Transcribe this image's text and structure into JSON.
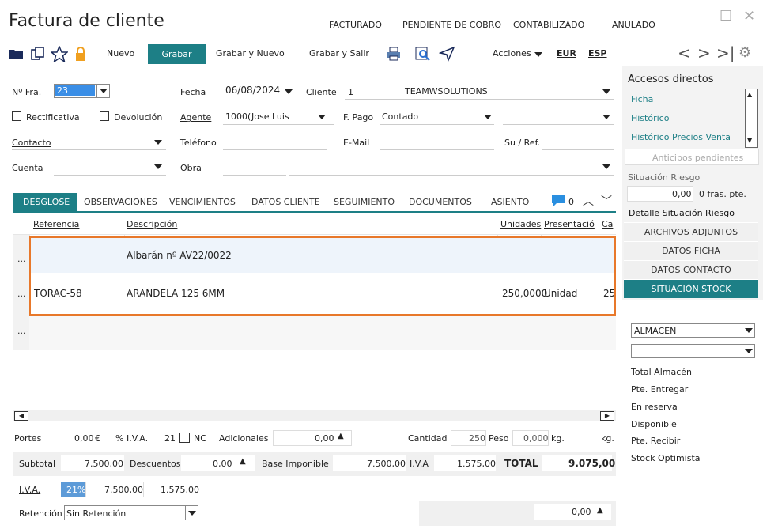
{
  "title": "Factura de cliente",
  "status": [
    "FACTURADO",
    "PENDIENTE DE COBRO",
    "CONTABILIZADO",
    "ANULADO"
  ],
  "toolbar": {
    "nuevo": "Nuevo",
    "grabar": "Grabar",
    "grabar_nuevo": "Grabar y Nuevo",
    "grabar_salir": "Grabar y Salir",
    "acciones": "Acciones",
    "eur": "EUR",
    "esp": "ESP"
  },
  "header": {
    "nfra_label": "Nº Fra.",
    "nfra": "23",
    "fecha_label": "Fecha",
    "fecha": "06/08/2024",
    "cliente_label": "Cliente",
    "cliente_code": "1",
    "cliente_name": "TEAMWSOLUTIONS",
    "rectificativa": "Rectificativa",
    "devolucion": "Devolución",
    "agente_label": "Agente",
    "agente_code": "1000(",
    "agente_name": "Jose Luis",
    "fpago_label": "F. Pago",
    "fpago": "Contado",
    "contacto_label": "Contacto",
    "telefono_label": "Teléfono",
    "email_label": "E-Mail",
    "suref_label": "Su / Ref.",
    "cuenta_label": "Cuenta",
    "obra_label": "Obra"
  },
  "tabs": [
    "DESGLOSE",
    "OBSERVACIONES",
    "VENCIMIENTOS",
    "DATOS CLIENTE",
    "SEGUIMIENTO",
    "DOCUMENTOS",
    "ASIENTO"
  ],
  "comment_count": "0",
  "grid": {
    "headers": [
      "Referencia",
      "Descripción",
      "Unidades",
      "Presentació",
      "Ca"
    ],
    "rows": [
      {
        "marker": "...",
        "ref": "",
        "desc": "Albarán nº AV22/0022",
        "units": "",
        "pres": "",
        "ca": ""
      },
      {
        "marker": "...",
        "ref": "TORAC-58",
        "desc": "ARANDELA 125 6MM",
        "units": "250,0000",
        "pres": "Unidad",
        "ca": "25"
      },
      {
        "marker": "...",
        "ref": "",
        "desc": "",
        "units": "",
        "pres": "",
        "ca": ""
      }
    ]
  },
  "totals": {
    "portes_label": "Portes",
    "portes": "0,00",
    "euro": "€",
    "piva_label": "% I.V.A.",
    "piva": "21",
    "nc": "NC",
    "adicionales_label": "Adicionales",
    "adicionales": "0,00",
    "cantidad_label": "Cantidad",
    "cantidad": "250",
    "peso_label": "Peso",
    "peso": "0,000",
    "kg": "kg.",
    "kg2": "kg.",
    "subtotal_label": "Subtotal",
    "subtotal": "7.500,00",
    "descuentos_label": "Descuentos",
    "descuentos": "0,00",
    "base_label": "Base Imponible",
    "base": "7.500,00",
    "iva_label": "I.V.A",
    "iva": "1.575,00",
    "total_label": "TOTAL",
    "total": "9.075,00",
    "iva_row_label": "I.V.A.",
    "iva_pct": "21%",
    "iva_base": "7.500,00",
    "iva_amt": "1.575,00",
    "retencion_label": "Retención",
    "retencion": "Sin Retención",
    "bottom_amt": "0,00"
  },
  "side": {
    "accesos": "Accesos directos",
    "links": [
      "Ficha",
      "Histórico",
      "Histórico Precios Venta"
    ],
    "anticipos": "Anticipos pendientes",
    "riesgo": "Situación Riesgo",
    "riesgo_val": "0,00",
    "riesgo_fras": "0 fras. pte.",
    "detalle": "Detalle Situación Riesgo",
    "tabs": [
      "ARCHIVOS ADJUNTOS",
      "DATOS FICHA",
      "DATOS CONTACTO",
      "SITUACIÓN STOCK"
    ],
    "almacen": "ALMACEN",
    "stock": [
      "Total Almacén",
      "Pte. Entregar",
      "En reserva",
      "Disponible",
      "Pte. Recibir",
      "Stock Optimista"
    ]
  }
}
